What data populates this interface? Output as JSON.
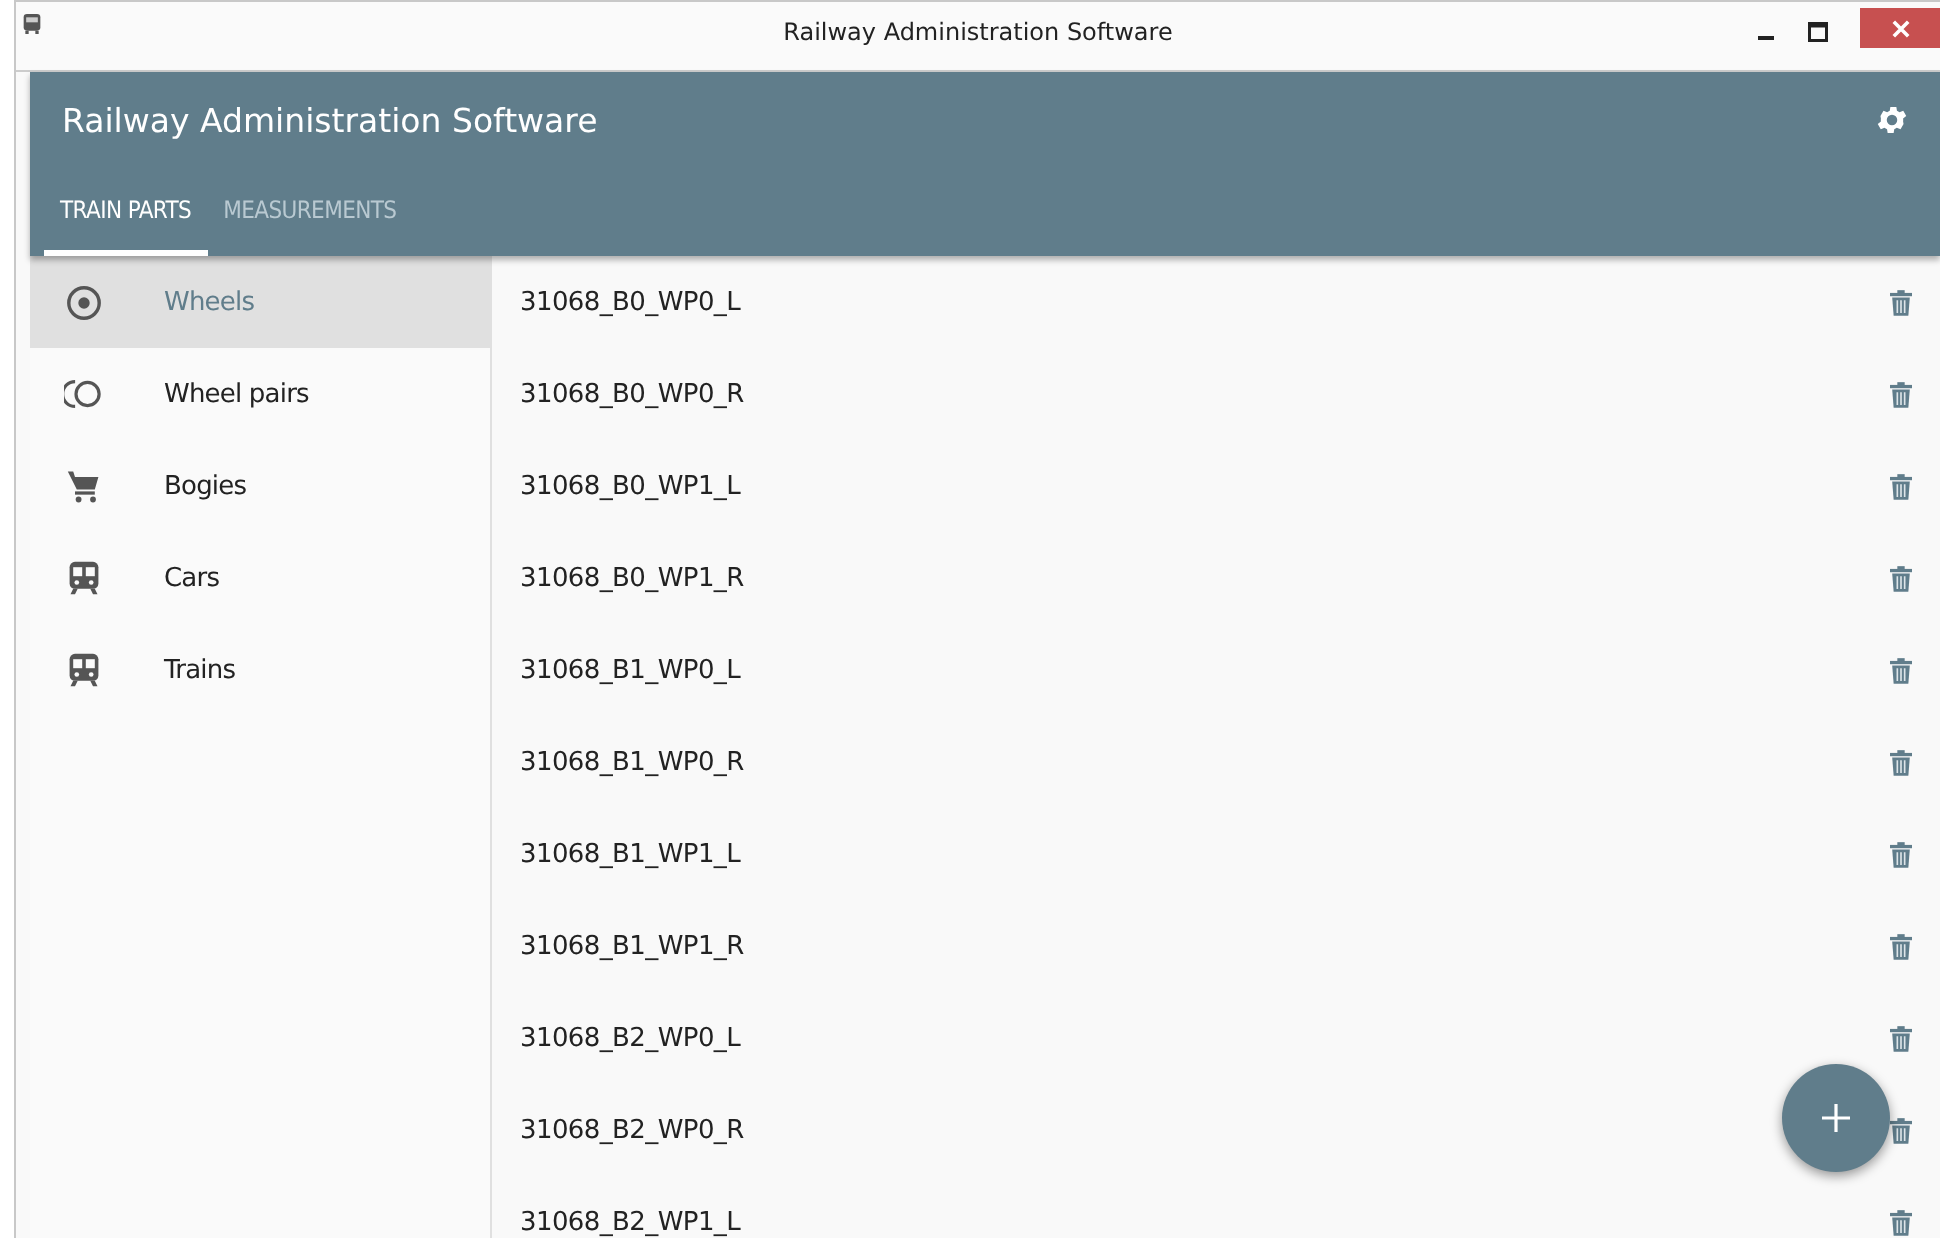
{
  "window": {
    "title": "Railway Administration Software"
  },
  "app_bar": {
    "title": "Railway Administration Software"
  },
  "tabs": [
    {
      "label": "TRAIN PARTS",
      "selected": true
    },
    {
      "label": "MEASUREMENTS",
      "selected": false
    }
  ],
  "sidebar": {
    "items": [
      {
        "label": "Wheels",
        "kind": "wheel",
        "selected": true
      },
      {
        "label": "Wheel pairs",
        "kind": "wheelpair",
        "selected": false
      },
      {
        "label": "Bogies",
        "kind": "cart",
        "selected": false
      },
      {
        "label": "Cars",
        "kind": "train",
        "selected": false
      },
      {
        "label": "Trains",
        "kind": "train",
        "selected": false
      }
    ]
  },
  "list": {
    "rows": [
      "31068_B0_WP0_L",
      "31068_B0_WP0_R",
      "31068_B0_WP1_L",
      "31068_B0_WP1_R",
      "31068_B1_WP0_L",
      "31068_B1_WP0_R",
      "31068_B1_WP1_L",
      "31068_B1_WP1_R",
      "31068_B2_WP0_L",
      "31068_B2_WP0_R",
      "31068_B2_WP1_L"
    ]
  }
}
